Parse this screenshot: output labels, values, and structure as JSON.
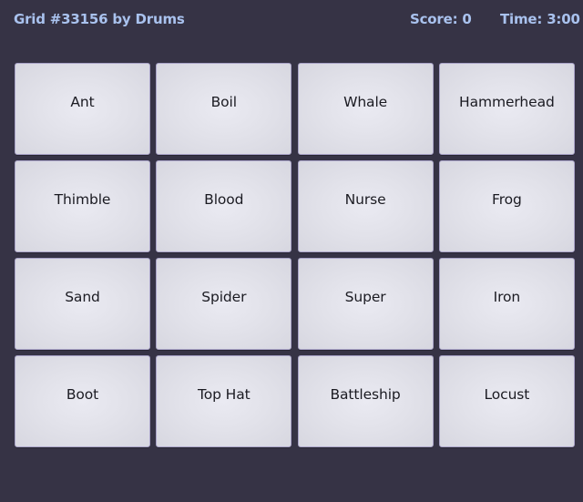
{
  "header": {
    "title": "Grid #33156 by Drums",
    "score": "Score: 0",
    "time": "Time: 3:00"
  },
  "tiles": [
    "Ant",
    "Boil",
    "Whale",
    "Hammerhead",
    "Thimble",
    "Blood",
    "Nurse",
    "Frog",
    "Sand",
    "Spider",
    "Super",
    "Iron",
    "Boot",
    "Top Hat",
    "Battleship",
    "Locust"
  ],
  "colors": {
    "background": "#363345",
    "header_text": "#a9c2ee",
    "tile_text": "#1b1b22",
    "tile_border": "#a9a3c8"
  }
}
